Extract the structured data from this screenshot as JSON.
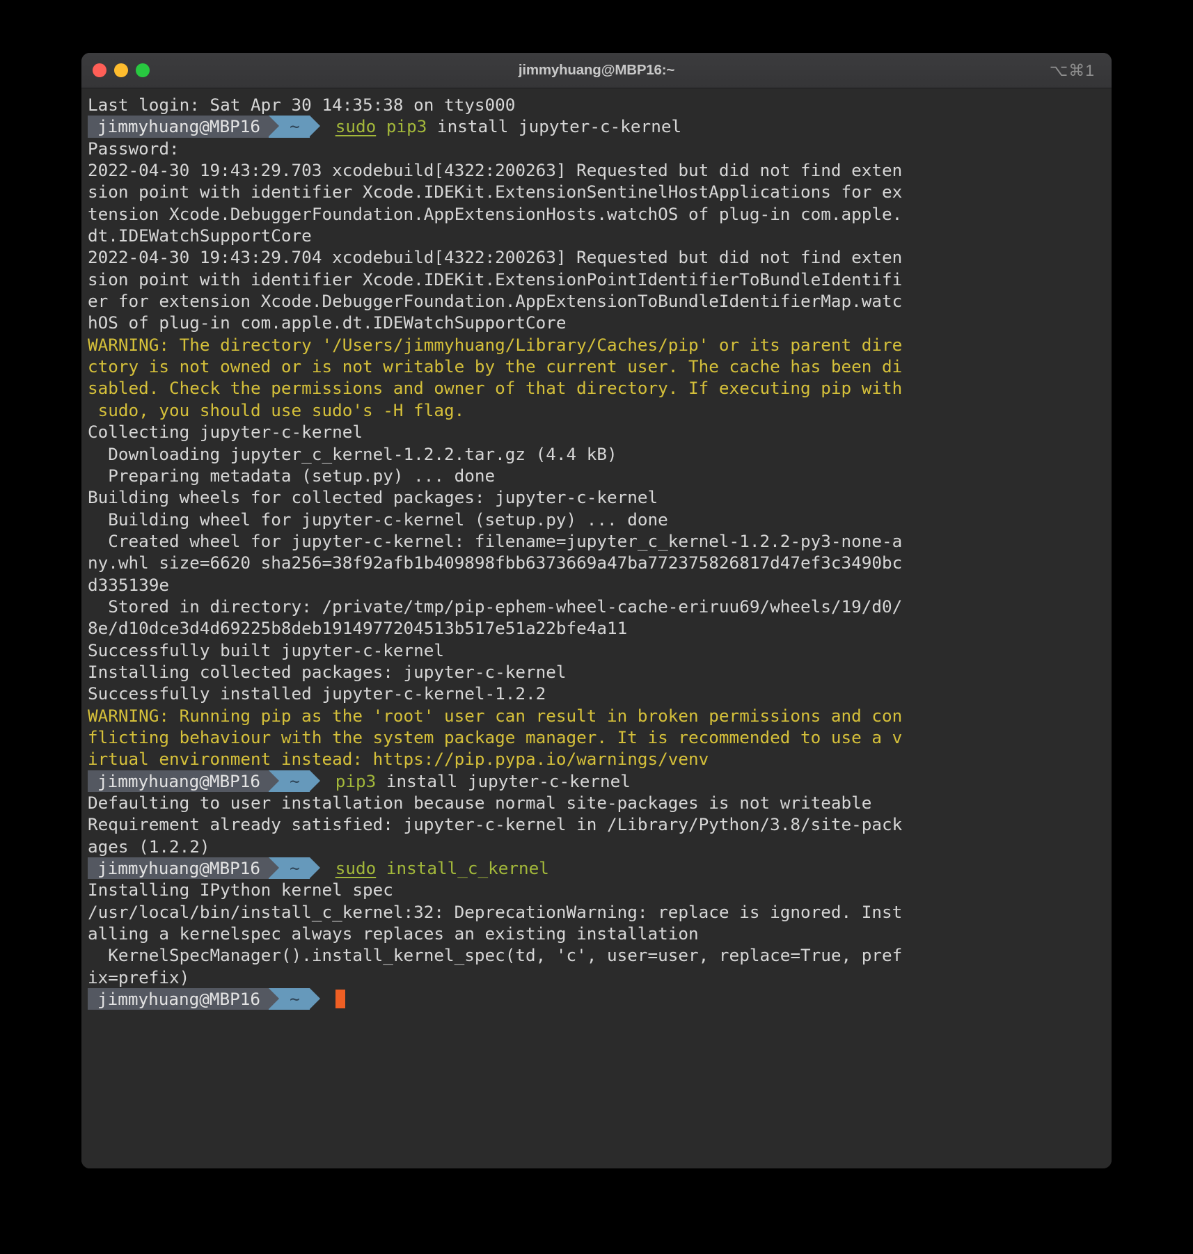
{
  "window": {
    "title": "jimmyhuang@MBP16:~",
    "keyboard_shortcut_hint": "⌥⌘1",
    "traffic_lights": [
      {
        "name": "close",
        "color": "#ff5f57"
      },
      {
        "name": "minimize",
        "color": "#febc2e"
      },
      {
        "name": "maximize",
        "color": "#28c840"
      }
    ]
  },
  "theme": {
    "background": "#2b2b2b",
    "foreground": "#d6d6d6",
    "warning": "#d5c03a",
    "green": "#a3b83a",
    "prompt_host_bg": "#545861",
    "prompt_path_bg": "#6699bb",
    "cursor": "#ef5f24"
  },
  "prompt": {
    "host": "jimmyhuang@MBP16",
    "path": "~"
  },
  "terminal": {
    "lines": [
      {
        "type": "text",
        "color": "default",
        "text": "Last login: Sat Apr 30 14:35:38 on ttys000"
      },
      {
        "type": "prompt",
        "command_parts": [
          {
            "text": "sudo",
            "color": "green",
            "underline": true
          },
          {
            "text": " ",
            "color": "default",
            "underline": false
          },
          {
            "text": "pip3",
            "color": "green",
            "underline": false
          },
          {
            "text": " install jupyter-c-kernel",
            "color": "default",
            "underline": false
          }
        ]
      },
      {
        "type": "text",
        "color": "default",
        "text": "Password:"
      },
      {
        "type": "text",
        "color": "default",
        "text": "2022-04-30 19:43:29.703 xcodebuild[4322:200263] Requested but did not find exten"
      },
      {
        "type": "text",
        "color": "default",
        "text": "sion point with identifier Xcode.IDEKit.ExtensionSentinelHostApplications for ex"
      },
      {
        "type": "text",
        "color": "default",
        "text": "tension Xcode.DebuggerFoundation.AppExtensionHosts.watchOS of plug-in com.apple."
      },
      {
        "type": "text",
        "color": "default",
        "text": "dt.IDEWatchSupportCore"
      },
      {
        "type": "text",
        "color": "default",
        "text": "2022-04-30 19:43:29.704 xcodebuild[4322:200263] Requested but did not find exten"
      },
      {
        "type": "text",
        "color": "default",
        "text": "sion point with identifier Xcode.IDEKit.ExtensionPointIdentifierToBundleIdentifi"
      },
      {
        "type": "text",
        "color": "default",
        "text": "er for extension Xcode.DebuggerFoundation.AppExtensionToBundleIdentifierMap.watc"
      },
      {
        "type": "text",
        "color": "default",
        "text": "hOS of plug-in com.apple.dt.IDEWatchSupportCore"
      },
      {
        "type": "text",
        "color": "warn",
        "text": "WARNING: The directory '/Users/jimmyhuang/Library/Caches/pip' or its parent dire"
      },
      {
        "type": "text",
        "color": "warn",
        "text": "ctory is not owned or is not writable by the current user. The cache has been di"
      },
      {
        "type": "text",
        "color": "warn",
        "text": "sabled. Check the permissions and owner of that directory. If executing pip with"
      },
      {
        "type": "text",
        "color": "warn",
        "text": " sudo, you should use sudo's -H flag."
      },
      {
        "type": "text",
        "color": "default",
        "text": "Collecting jupyter-c-kernel"
      },
      {
        "type": "text",
        "color": "default",
        "text": "  Downloading jupyter_c_kernel-1.2.2.tar.gz (4.4 kB)"
      },
      {
        "type": "text",
        "color": "default",
        "text": "  Preparing metadata (setup.py) ... done"
      },
      {
        "type": "text",
        "color": "default",
        "text": "Building wheels for collected packages: jupyter-c-kernel"
      },
      {
        "type": "text",
        "color": "default",
        "text": "  Building wheel for jupyter-c-kernel (setup.py) ... done"
      },
      {
        "type": "text",
        "color": "default",
        "text": "  Created wheel for jupyter-c-kernel: filename=jupyter_c_kernel-1.2.2-py3-none-a"
      },
      {
        "type": "text",
        "color": "default",
        "text": "ny.whl size=6620 sha256=38f92afb1b409898fbb6373669a47ba772375826817d47ef3c3490bc"
      },
      {
        "type": "text",
        "color": "default",
        "text": "d335139e"
      },
      {
        "type": "text",
        "color": "default",
        "text": "  Stored in directory: /private/tmp/pip-ephem-wheel-cache-eriruu69/wheels/19/d0/"
      },
      {
        "type": "text",
        "color": "default",
        "text": "8e/d10dce3d4d69225b8deb1914977204513b517e51a22bfe4a11"
      },
      {
        "type": "text",
        "color": "default",
        "text": "Successfully built jupyter-c-kernel"
      },
      {
        "type": "text",
        "color": "default",
        "text": "Installing collected packages: jupyter-c-kernel"
      },
      {
        "type": "text",
        "color": "default",
        "text": "Successfully installed jupyter-c-kernel-1.2.2"
      },
      {
        "type": "text",
        "color": "warn",
        "text": "WARNING: Running pip as the 'root' user can result in broken permissions and con"
      },
      {
        "type": "text",
        "color": "warn",
        "text": "flicting behaviour with the system package manager. It is recommended to use a v"
      },
      {
        "type": "text",
        "color": "warn",
        "text": "irtual environment instead: https://pip.pypa.io/warnings/venv"
      },
      {
        "type": "prompt",
        "command_parts": [
          {
            "text": "pip3",
            "color": "green",
            "underline": false
          },
          {
            "text": " install jupyter-c-kernel",
            "color": "default",
            "underline": false
          }
        ]
      },
      {
        "type": "text",
        "color": "default",
        "text": "Defaulting to user installation because normal site-packages is not writeable"
      },
      {
        "type": "text",
        "color": "default",
        "text": "Requirement already satisfied: jupyter-c-kernel in /Library/Python/3.8/site-pack"
      },
      {
        "type": "text",
        "color": "default",
        "text": "ages (1.2.2)"
      },
      {
        "type": "prompt",
        "command_parts": [
          {
            "text": "sudo",
            "color": "green",
            "underline": true
          },
          {
            "text": " ",
            "color": "default",
            "underline": false
          },
          {
            "text": "install_c_kernel",
            "color": "green",
            "underline": false
          }
        ]
      },
      {
        "type": "text",
        "color": "default",
        "text": "Installing IPython kernel spec"
      },
      {
        "type": "text",
        "color": "default",
        "text": "/usr/local/bin/install_c_kernel:32: DeprecationWarning: replace is ignored. Inst"
      },
      {
        "type": "text",
        "color": "default",
        "text": "alling a kernelspec always replaces an existing installation"
      },
      {
        "type": "text",
        "color": "default",
        "text": "  KernelSpecManager().install_kernel_spec(td, 'c', user=user, replace=True, pref"
      },
      {
        "type": "text",
        "color": "default",
        "text": "ix=prefix)"
      },
      {
        "type": "prompt",
        "command_parts": [],
        "cursor": true
      }
    ]
  }
}
